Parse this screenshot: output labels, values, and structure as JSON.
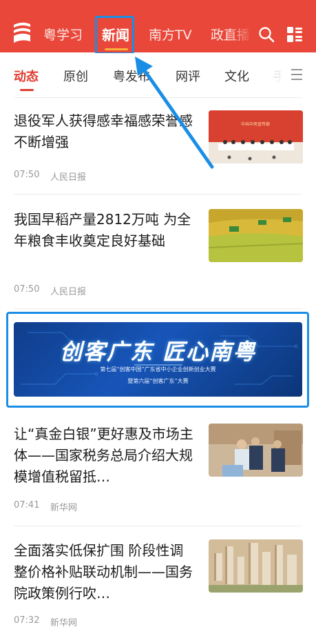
{
  "header": {
    "nav": [
      "粤学习",
      "新闻",
      "南方TV",
      "政直播"
    ],
    "active": "新闻"
  },
  "subtabs": [
    "动态",
    "原创",
    "粤发布",
    "网评",
    "文化",
    "手"
  ],
  "articles": [
    {
      "title": "退役军人获得感幸福感荣誉感不断增强",
      "time": "07:50",
      "source": "人民日报",
      "thumb_text": "中共中央宣传部",
      "thumb": "press-conference-photo"
    },
    {
      "title": "我国早稻产量2812万吨 为全年粮食丰收奠定良好基础",
      "time": "07:50",
      "source": "人民日报",
      "thumb": "rice-harvest-photo"
    },
    {
      "title": "让“真金白银”更好惠及市场主体——国家税务总局介绍大规模增值税留抵…",
      "time": "07:41",
      "source": "新华网",
      "thumb": "tax-officials-photo"
    },
    {
      "title": "全面落实低保扩围 阶段性调整价格补贴联动机制——国务院政策例行吹…",
      "time": "07:32",
      "source": "新华网",
      "thumb": "city-buildings-photo"
    }
  ],
  "banner": {
    "title": "创客广东 匠心南粤",
    "line1": "第七届“创客中国”广东省中小企业创新创业大赛",
    "line2": "暨第六届“创客广东”大赛"
  },
  "colors": {
    "header_bg": "#e8473a",
    "accent_red": "#e03b2e",
    "annotation_blue": "#1a8ee6"
  }
}
